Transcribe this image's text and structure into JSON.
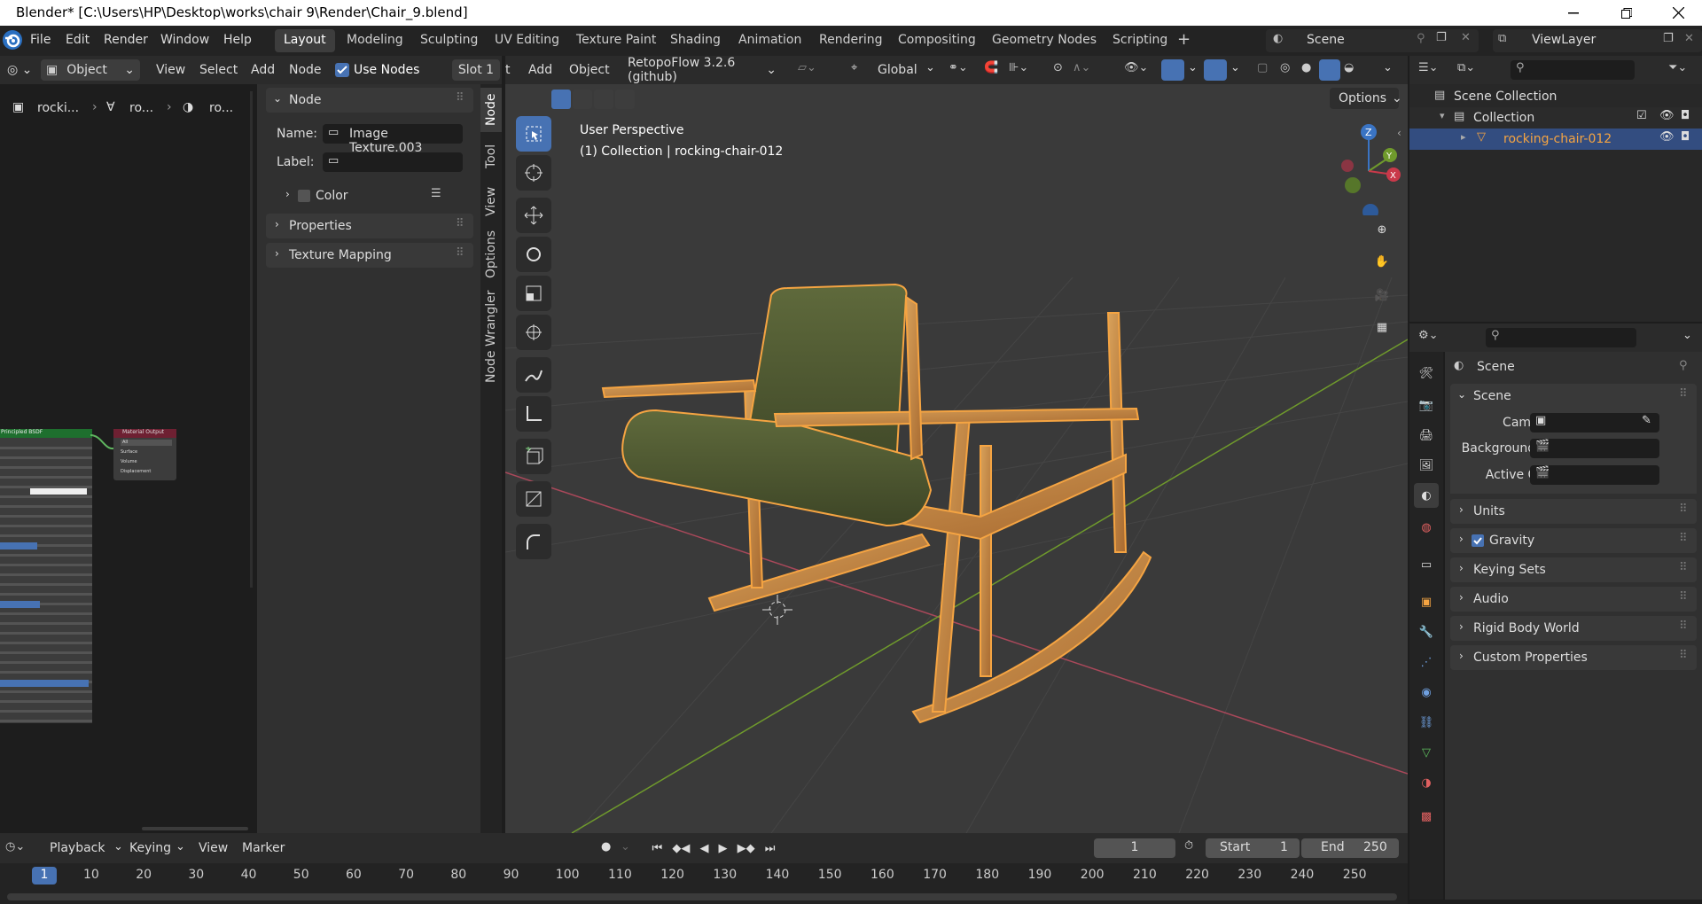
{
  "window": {
    "title": "Blender* [C:\\Users\\HP\\Desktop\\works\\chair 9\\Render\\Chair_9.blend]"
  },
  "menu": {
    "file": "File",
    "edit": "Edit",
    "render": "Render",
    "window": "Window",
    "help": "Help"
  },
  "workspaces": [
    "Layout",
    "Modeling",
    "Sculpting",
    "UV Editing",
    "Texture Paint",
    "Shading",
    "Animation",
    "Rendering",
    "Compositing",
    "Geometry Nodes",
    "Scripting"
  ],
  "scene_name": "Scene",
  "view_layer": "ViewLayer",
  "node_editor": {
    "mode": "Object",
    "view": "View",
    "select": "Select",
    "add": "Add",
    "node": "Node",
    "use_nodes": "Use Nodes",
    "slot": "Slot 1",
    "breadcrumb": [
      "rocki...",
      "ro...",
      "ro..."
    ],
    "sidebar": {
      "section": "Node",
      "name_label": "Name:",
      "name_value": "Image Texture.003",
      "label_label": "Label:",
      "color": "Color",
      "properties": "Properties",
      "texture_mapping": "Texture Mapping"
    },
    "tabs": [
      "Node",
      "Tool",
      "View",
      "Options",
      "Node Wrangler"
    ],
    "bsdf_title": "Principled BSDF",
    "output_title": "Material Output",
    "output_sockets": [
      "All",
      "Surface",
      "Volume",
      "Displacement"
    ]
  },
  "viewport": {
    "add": "Add",
    "object": "Object",
    "retopo": "RetopoFlow 3.2.6 (github)",
    "orientation": "Global",
    "options": "Options",
    "perspective": "User Perspective",
    "collection_label": "(1) Collection | rocking-chair-012",
    "header_cut": "t"
  },
  "outliner": {
    "scene_collection": "Scene Collection",
    "collection": "Collection",
    "object": "rocking-chair-012"
  },
  "properties": {
    "title": "Scene",
    "section": "Scene",
    "camera": "Camera",
    "background": "Background ...",
    "active_clip": "Active Clip",
    "panels": [
      "Units",
      "Gravity",
      "Keying Sets",
      "Audio",
      "Rigid Body World",
      "Custom Properties"
    ]
  },
  "timeline": {
    "playback": "Playback",
    "keying": "Keying",
    "view": "View",
    "marker": "Marker",
    "current_frame": "1",
    "start_label": "Start",
    "start": "1",
    "end_label": "End",
    "end": "250",
    "ticks": [
      "1",
      "10",
      "20",
      "30",
      "40",
      "50",
      "60",
      "70",
      "80",
      "90",
      "100",
      "110",
      "120",
      "130",
      "140",
      "150",
      "160",
      "170",
      "180",
      "190",
      "200",
      "210",
      "220",
      "230",
      "240",
      "250"
    ]
  },
  "colors": {
    "accent": "#4772b3",
    "selection": "#f5a442",
    "bg": "#3a3a3a"
  }
}
